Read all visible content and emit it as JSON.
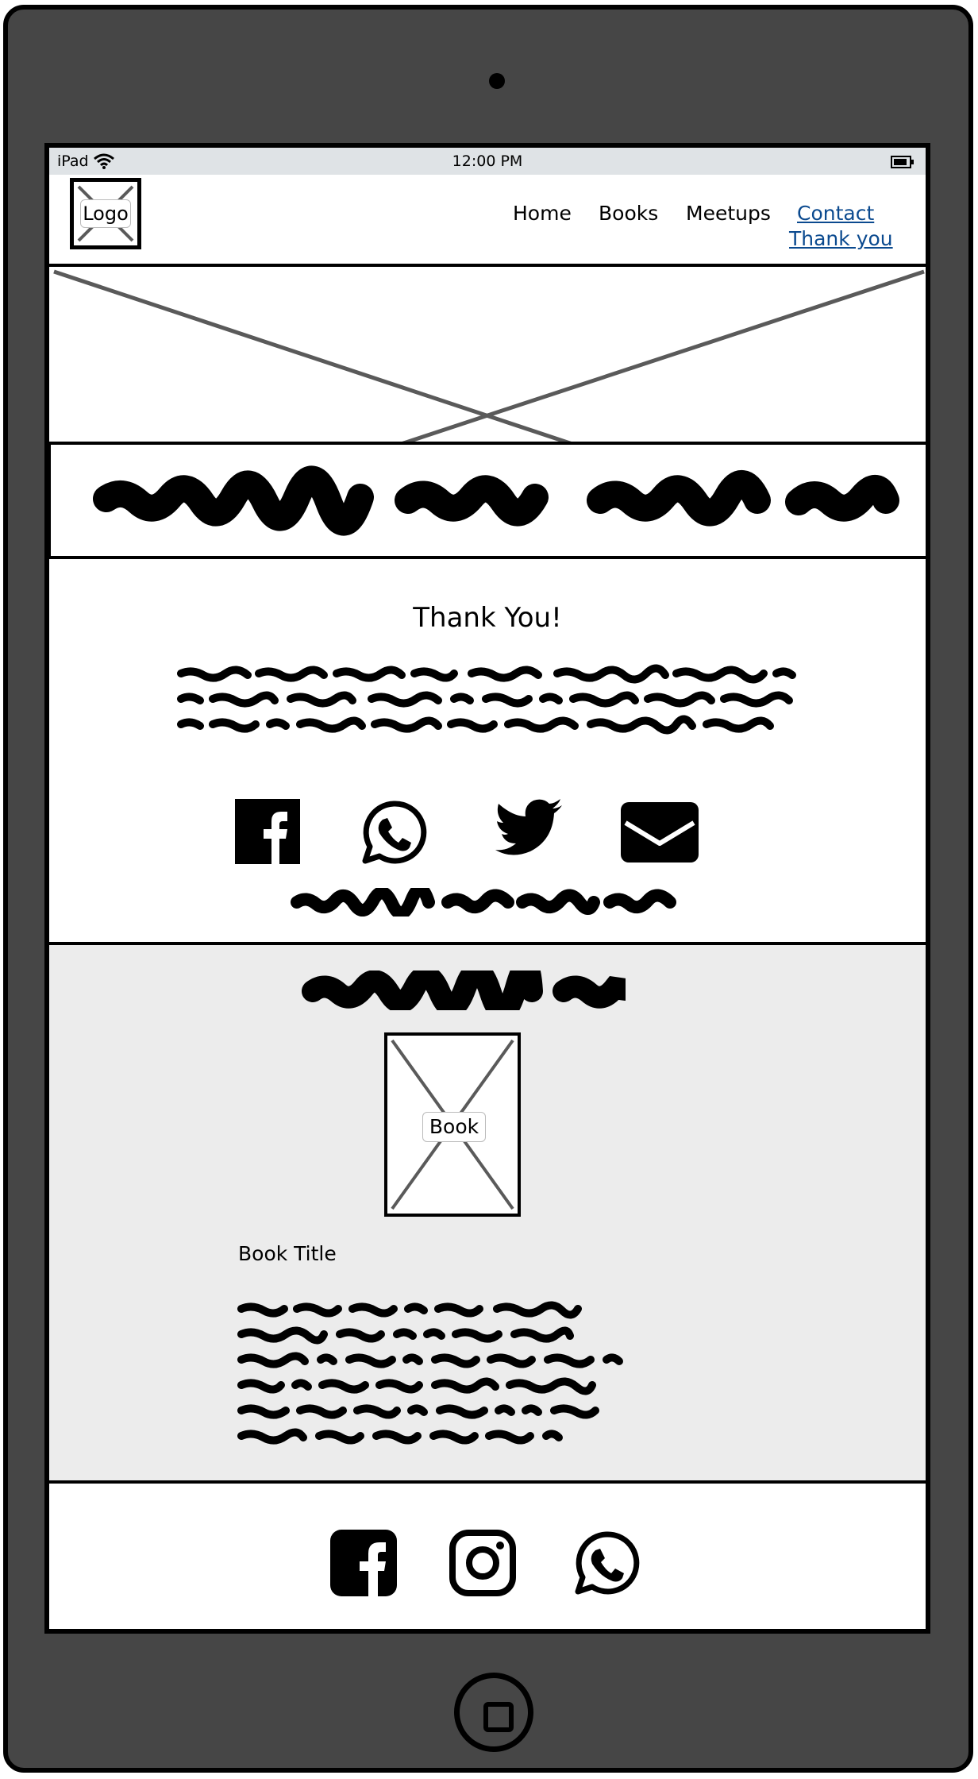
{
  "status_bar": {
    "device": "iPad",
    "time": "12:00 PM"
  },
  "logo": {
    "label": "Logo"
  },
  "nav": {
    "items": [
      {
        "label": "Home"
      },
      {
        "label": "Books"
      },
      {
        "label": "Meetups"
      },
      {
        "label": "Contact"
      },
      {
        "label": "Thank you"
      }
    ],
    "active_color": "#0b4a8f"
  },
  "thank_you": {
    "heading": "Thank You!",
    "social_icons": [
      "facebook-icon",
      "whatsapp-icon",
      "twitter-icon",
      "email-icon"
    ]
  },
  "books_section": {
    "book_image_label": "Book",
    "book_title": "Book Title"
  },
  "footer": {
    "social_icons": [
      "facebook-icon",
      "instagram-icon",
      "whatsapp-icon"
    ]
  },
  "colors": {
    "device_frame": "#464646",
    "status_bar": "#dfe3e6",
    "section_bg": "#ececec"
  }
}
